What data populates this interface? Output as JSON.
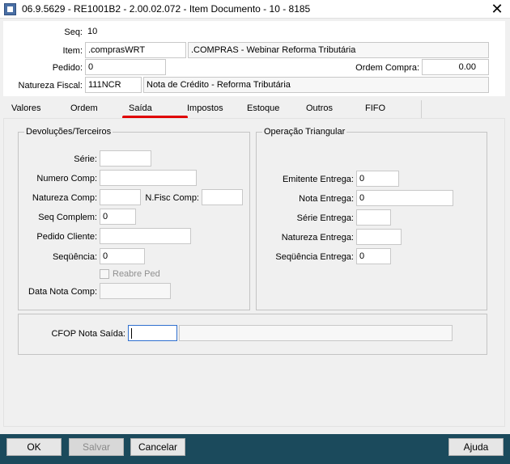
{
  "window": {
    "title": "06.9.5629 - RE1001B2 - 2.00.02.072 - Item Documento - 10 - 8185",
    "close_glyph": "✕"
  },
  "header": {
    "seq_label": "Seq:",
    "seq_value": "10",
    "item_label": "Item:",
    "item_code": ".comprasWRT",
    "item_desc": ".COMPRAS - Webinar Reforma Tributária",
    "pedido_label": "Pedido:",
    "pedido_value": "0",
    "ordem_label": "Ordem Compra:",
    "ordem_value": "0.00",
    "natureza_label": "Natureza Fiscal:",
    "natureza_code": "111NCR",
    "natureza_desc": "Nota de Crédito - Reforma Tributária"
  },
  "tabs": [
    "Valores",
    "Ordem",
    "Saída",
    "Impostos",
    "Estoque",
    "Outros",
    "FIFO"
  ],
  "active_tab": "Saída",
  "devolucoes": {
    "title": "Devoluções/Terceiros",
    "serie_label": "Série:",
    "serie_value": "",
    "numero_label": "Numero Comp:",
    "numero_value": "",
    "natureza_label": "Natureza Comp:",
    "natureza_value": "",
    "nfisc_label": "N.Fisc Comp:",
    "nfisc_value": "",
    "seq_complem_label": "Seq Complem:",
    "seq_complem_value": "0",
    "pedido_cliente_label": "Pedido Cliente:",
    "pedido_cliente_value": "",
    "sequencia_label": "Seqüência:",
    "sequencia_value": "0",
    "reabre_label": "Reabre Ped",
    "data_label": "Data Nota Comp:",
    "data_value": ""
  },
  "triangular": {
    "title": "Operação Triangular",
    "emitente_label": "Emitente Entrega:",
    "emitente_value": "0",
    "nota_label": "Nota Entrega:",
    "nota_value": "0",
    "serie_label": "Série Entrega:",
    "serie_value": "",
    "natureza_label": "Natureza Entrega:",
    "natureza_value": "",
    "sequencia_label": "Seqüência Entrega:",
    "sequencia_value": "0"
  },
  "cfop": {
    "label": "CFOP Nota Saída:",
    "value": "",
    "desc": ""
  },
  "buttons": {
    "ok": "OK",
    "salvar": "Salvar",
    "cancelar": "Cancelar",
    "ajuda": "Ajuda"
  },
  "colors": {
    "bottom_bar": "#1b4a5c",
    "tab_highlight": "#e00000",
    "focus_border": "#2f6fcf"
  }
}
